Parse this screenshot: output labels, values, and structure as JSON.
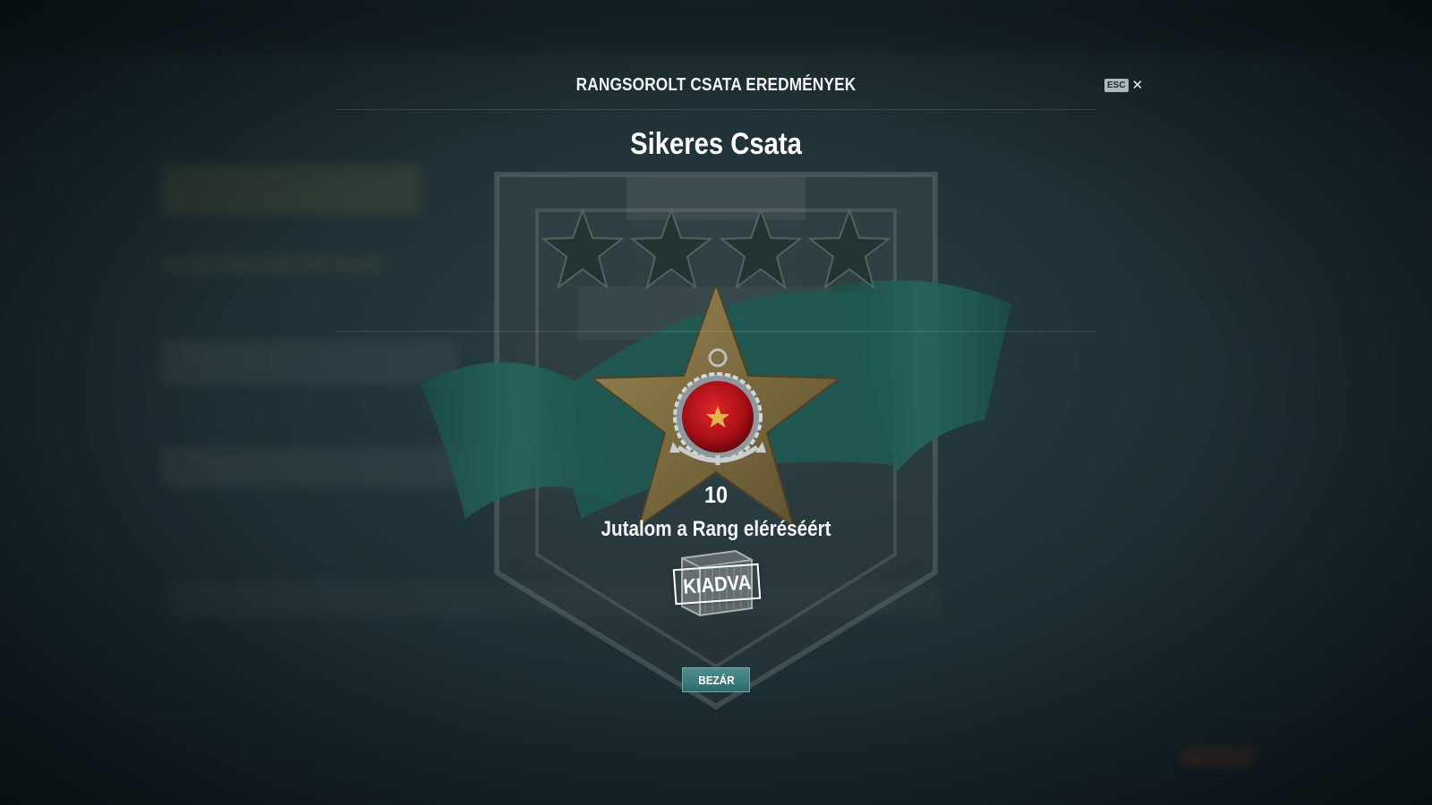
{
  "header": {
    "title": "RANGSOROLT CSATA EREDMÉNYEK",
    "esc_label": "ESC",
    "close_glyph": "✕"
  },
  "result": {
    "title": "Sikeres Csata",
    "stars_total": 4,
    "stars_filled": 0,
    "rank": "10",
    "reward_label": "Jutalom a Rang eléréséért",
    "reward_status": "KIADVA"
  },
  "footer": {
    "close_button_label": "BEZÁR"
  },
  "colors": {
    "accent_teal": "#2f6b6e",
    "medal_red": "#c0141b",
    "star_bronze": "#8a7748",
    "ribbon_teal": "#1f5a52"
  },
  "icons": [
    "close-icon",
    "empty-star-icon",
    "rank-insignia-icon",
    "supply-crate-icon"
  ]
}
